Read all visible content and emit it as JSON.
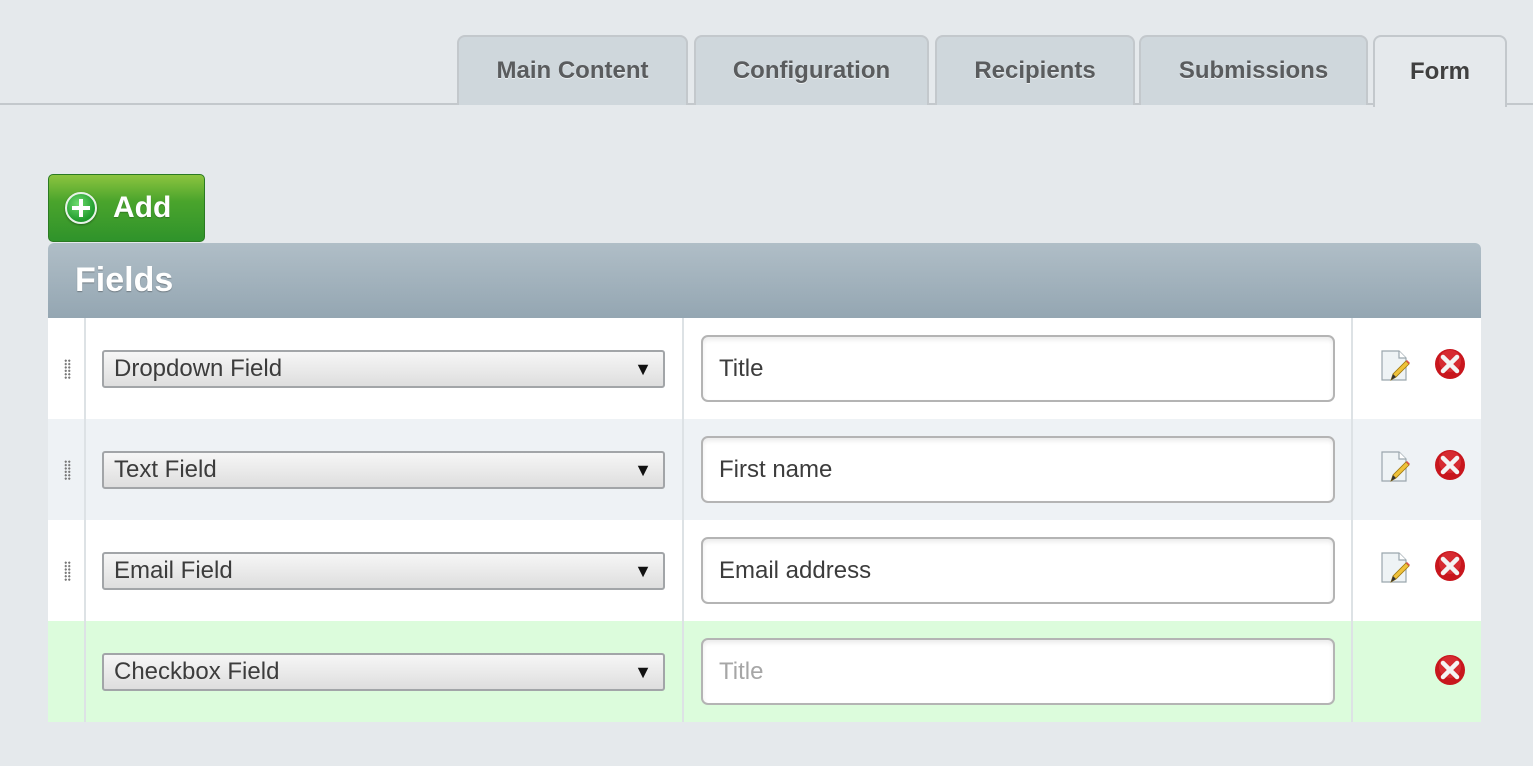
{
  "tabs": [
    {
      "label": "Main Content",
      "active": false
    },
    {
      "label": "Configuration",
      "active": false
    },
    {
      "label": "Recipients",
      "active": false
    },
    {
      "label": "Submissions",
      "active": false
    },
    {
      "label": "Form",
      "active": true
    }
  ],
  "add_button": {
    "label": "Add",
    "icon": "plus-circle-icon"
  },
  "panel": {
    "title": "Fields",
    "rows": [
      {
        "type": "Dropdown Field",
        "title_value": "Title",
        "title_placeholder": "",
        "has_drag": true,
        "has_edit": true,
        "has_delete": true
      },
      {
        "type": "Text Field",
        "title_value": "First name",
        "title_placeholder": "",
        "has_drag": true,
        "has_edit": true,
        "has_delete": true
      },
      {
        "type": "Email Field",
        "title_value": "Email address",
        "title_placeholder": "",
        "has_drag": true,
        "has_edit": true,
        "has_delete": true
      },
      {
        "type": "Checkbox Field",
        "title_value": "",
        "title_placeholder": "Title",
        "has_drag": false,
        "has_edit": false,
        "has_delete": true
      }
    ]
  },
  "icons": {
    "select_arrow": "▼",
    "edit": "edit-document-icon",
    "delete": "delete-circle-icon",
    "drag": "drag-handle-icon"
  }
}
